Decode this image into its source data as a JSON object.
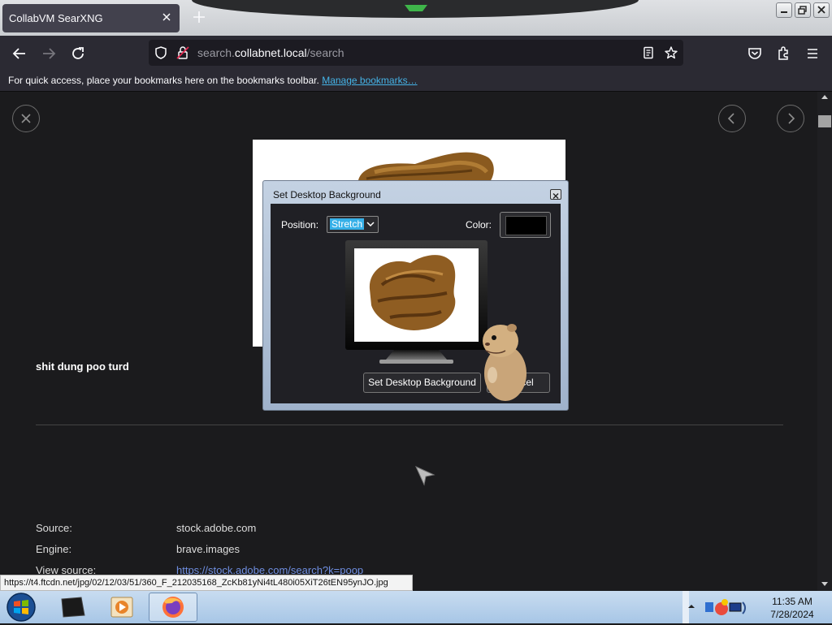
{
  "browser": {
    "tab_title": "CollabVM SearXNG",
    "url_prefix": "search.",
    "url_host": "collabnet.local",
    "url_path": "/search",
    "bookmarks_text": "For quick access, place your bookmarks here on the bookmarks toolbar.",
    "bookmarks_link": "Manage bookmarks…",
    "status_url": "https://t4.ftcdn.net/jpg/02/12/03/51/360_F_212035168_ZcKb81yNi4tL480i05XiT26tEN95ynJO.jpg"
  },
  "result": {
    "title": "shit dung poo turd",
    "source_label": "Source:",
    "source_value": "stock.adobe.com",
    "engine_label": "Engine:",
    "engine_value": "brave.images",
    "view_label": "View source:",
    "view_value": "https://stock.adobe.com/search?k=poop"
  },
  "dialog": {
    "title": "Set Desktop Background",
    "position_label": "Position:",
    "position_value": "Stretch",
    "color_label": "Color:",
    "set_button": "Set Desktop Background",
    "cancel_button": "Cancel"
  },
  "taskbar": {
    "time": "11:35 AM",
    "date": "7/28/2024"
  },
  "colors": {
    "accent": "#36b0e8",
    "link": "#45b3e7",
    "page_bg": "#1b1b1d"
  }
}
